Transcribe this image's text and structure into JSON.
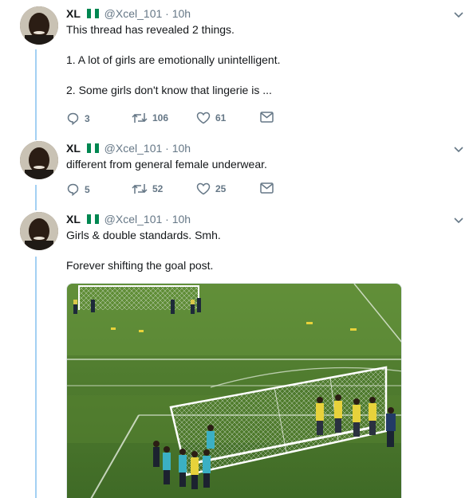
{
  "tweets": [
    {
      "name": "XL",
      "handle": "@Xcel_101",
      "time": "· 10h",
      "lines": [
        "This thread has revealed 2 things.",
        "",
        "1. A lot of girls are emotionally unintelligent.",
        "",
        "2. Some girls don't know that lingerie is ..."
      ],
      "replies": "3",
      "retweets": "106",
      "likes": "61"
    },
    {
      "name": "XL",
      "handle": "@Xcel_101",
      "time": "· 10h",
      "lines": [
        "different from general female underwear."
      ],
      "replies": "5",
      "retweets": "52",
      "likes": "25"
    },
    {
      "name": "XL",
      "handle": "@Xcel_101",
      "time": "· 10h",
      "lines": [
        "Girls & double standards. Smh.",
        "",
        "Forever shifting the goal post."
      ]
    }
  ],
  "colors": {
    "thread_line": "#a3d0f3",
    "flag_green": "#008751",
    "muted": "#657786",
    "pitch_grass": "#4a7a2e"
  },
  "icons": [
    "chevron-down-icon",
    "reply-icon",
    "retweet-icon",
    "like-icon",
    "dm-icon",
    "nigeria-flag-icon"
  ]
}
